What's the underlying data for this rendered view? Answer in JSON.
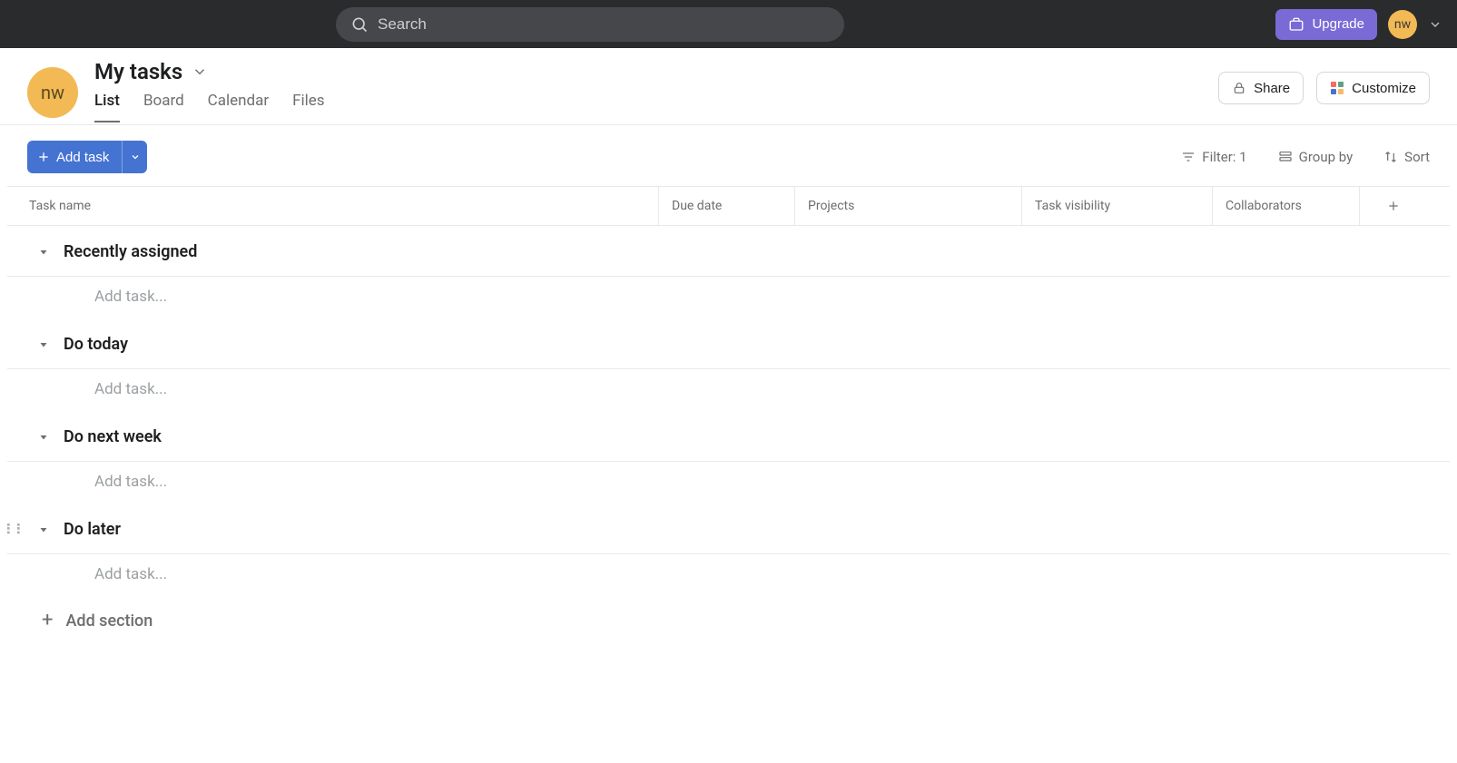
{
  "topbar": {
    "search_placeholder": "Search",
    "upgrade_label": "Upgrade",
    "avatar_initials": "nw"
  },
  "header": {
    "avatar_initials": "nw",
    "title": "My tasks",
    "tabs": [
      {
        "label": "List",
        "active": true
      },
      {
        "label": "Board",
        "active": false
      },
      {
        "label": "Calendar",
        "active": false
      },
      {
        "label": "Files",
        "active": false
      }
    ],
    "share_label": "Share",
    "customize_label": "Customize"
  },
  "toolbar": {
    "add_task_label": "Add task",
    "filter_label": "Filter: 1",
    "group_label": "Group by",
    "sort_label": "Sort"
  },
  "columns": {
    "task_name": "Task name",
    "due_date": "Due date",
    "projects": "Projects",
    "visibility": "Task visibility",
    "collaborators": "Collaborators"
  },
  "sections": [
    {
      "name": "Recently assigned",
      "add_task_placeholder": "Add task...",
      "drag_visible": false
    },
    {
      "name": "Do today",
      "add_task_placeholder": "Add task...",
      "drag_visible": false
    },
    {
      "name": "Do next week",
      "add_task_placeholder": "Add task...",
      "drag_visible": false
    },
    {
      "name": "Do later",
      "add_task_placeholder": "Add task...",
      "drag_visible": true
    }
  ],
  "add_section_label": "Add section"
}
